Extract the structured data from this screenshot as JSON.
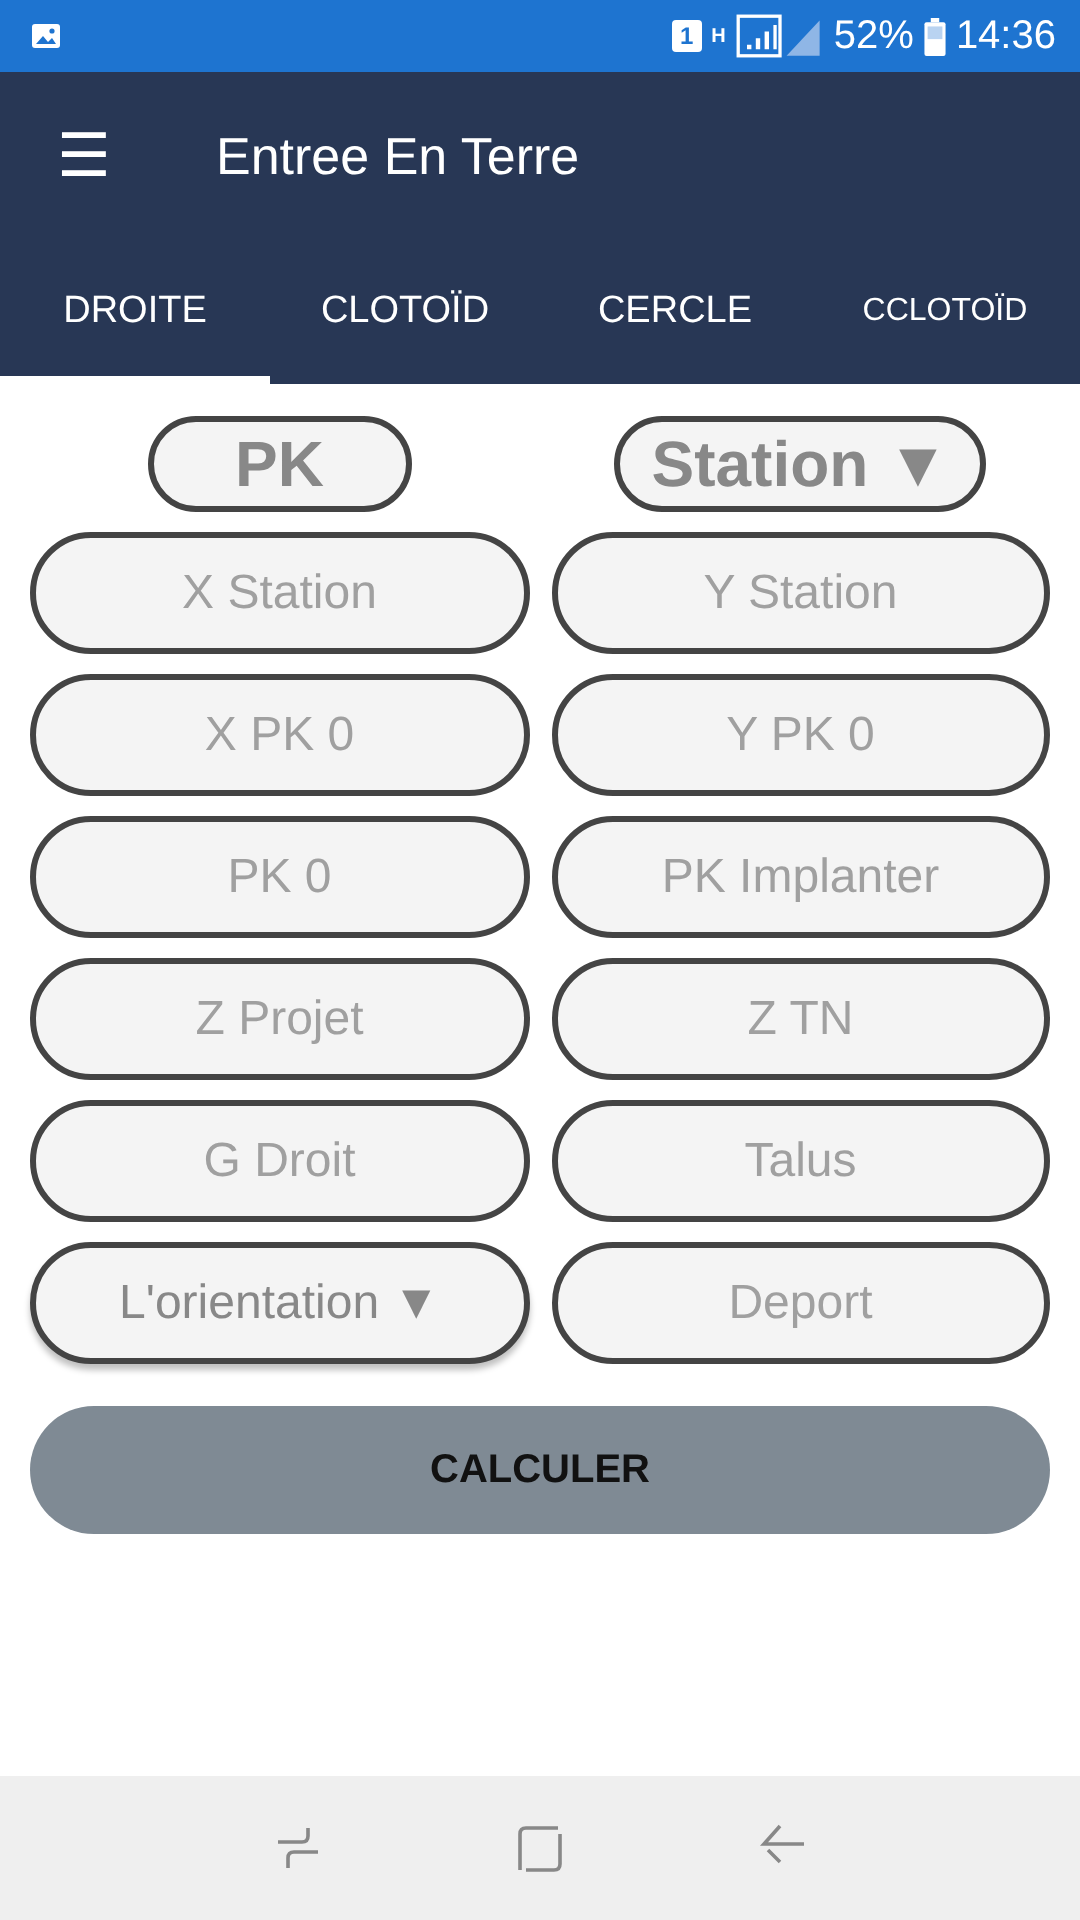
{
  "status_bar": {
    "battery": "52%",
    "time": "14:36",
    "sim": "1",
    "network": "H"
  },
  "app_bar": {
    "menu": "☰",
    "title": "Entree En Terre"
  },
  "tabs": [
    {
      "label": "DROITE",
      "selected": true
    },
    {
      "label": "CLOTOÏD",
      "selected": false
    },
    {
      "label": "CERCLE",
      "selected": false
    },
    {
      "label": "CCLOTOÏD",
      "selected": false
    }
  ],
  "header_controls": [
    {
      "kind": "label",
      "text": "PK"
    },
    {
      "kind": "dropdown",
      "text": "Station",
      "arrow": "▼"
    }
  ],
  "fields": [
    {
      "kind": "input",
      "placeholder": "X Station"
    },
    {
      "kind": "input",
      "placeholder": "Y Station"
    },
    {
      "kind": "input",
      "placeholder": "X PK 0"
    },
    {
      "kind": "input",
      "placeholder": "Y PK 0"
    },
    {
      "kind": "input",
      "placeholder": "PK 0"
    },
    {
      "kind": "input",
      "placeholder": "PK Implanter"
    },
    {
      "kind": "input",
      "placeholder": "Z Projet"
    },
    {
      "kind": "input",
      "placeholder": "Z TN"
    },
    {
      "kind": "input",
      "placeholder": "G Droit"
    },
    {
      "kind": "input",
      "placeholder": "Talus"
    },
    {
      "kind": "dropdown",
      "text": "L'orientation",
      "arrow": "▼"
    },
    {
      "kind": "input",
      "placeholder": "Deport"
    }
  ],
  "button": "CALCULER"
}
